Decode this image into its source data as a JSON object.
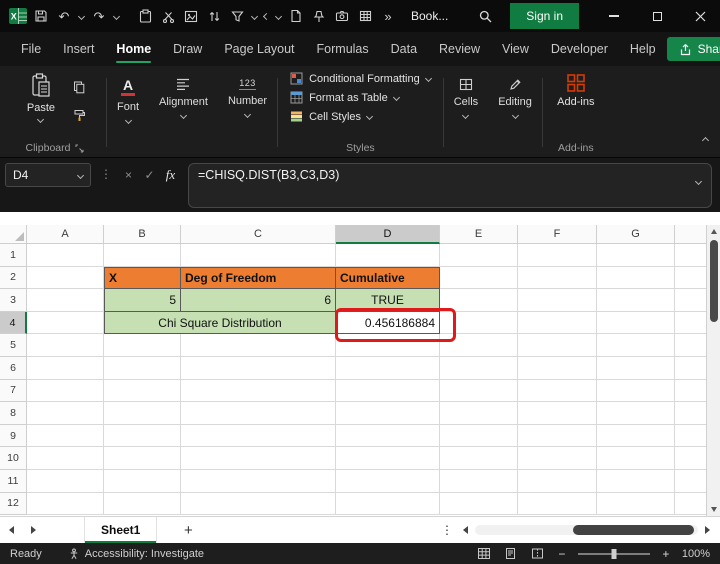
{
  "colors": {
    "excel_green": "#107C41",
    "tab_underline_green": "#21A366",
    "header_orange": "#ED7D31",
    "cell_green": "#C6E0B4",
    "annotation_red": "#DF1A1A"
  },
  "titlebar": {
    "workbook_name": "Book...",
    "sign_in_label": "Sign in"
  },
  "menubar": {
    "tabs": [
      "File",
      "Insert",
      "Home",
      "Draw",
      "Page Layout",
      "Formulas",
      "Data",
      "Review",
      "View",
      "Developer",
      "Help"
    ],
    "active_tab": "Home",
    "share_label": "Share"
  },
  "ribbon": {
    "paste_label": "Paste",
    "clipboard_group_label": "Clipboard",
    "font_label": "Font",
    "alignment_label": "Alignment",
    "number_label": "Number",
    "conditional_formatting_label": "Conditional Formatting",
    "format_as_table_label": "Format as Table",
    "cell_styles_label": "Cell Styles",
    "styles_group_label": "Styles",
    "cells_label": "Cells",
    "editing_label": "Editing",
    "addins_button_label": "Add-ins",
    "addins_group_label": "Add-ins"
  },
  "formula_bar": {
    "name_box_value": "D4",
    "fx_label": "fx",
    "formula": "=CHISQ.DIST(B3,C3,D3)"
  },
  "grid": {
    "column_headers": [
      "A",
      "B",
      "C",
      "D",
      "E",
      "F",
      "G"
    ],
    "row_headers": [
      "1",
      "2",
      "3",
      "4",
      "5",
      "6",
      "7",
      "8",
      "9",
      "10",
      "11",
      "12"
    ],
    "cells": {
      "B2": "X",
      "C2": "Deg of Freedom",
      "D2": "Cumulative",
      "B3": "5",
      "C3": "6",
      "D3": "TRUE",
      "B4_C4_merged": "Chi Square Distribution",
      "D4": "0.456186884"
    },
    "selection": {
      "active_cell": "D4",
      "selected_column": "D",
      "selected_row": "4"
    }
  },
  "sheet_bar": {
    "active_sheet": "Sheet1"
  },
  "status_bar": {
    "mode": "Ready",
    "accessibility_label": "Accessibility: Investigate",
    "zoom_level": "100%"
  }
}
